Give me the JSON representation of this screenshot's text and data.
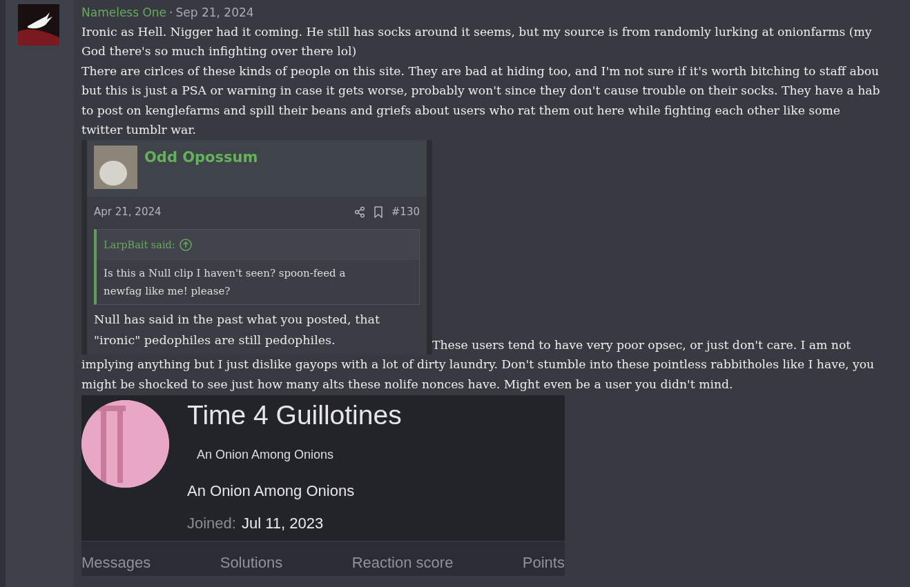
{
  "post": {
    "author": "Nameless One",
    "separator": "·",
    "date": "Sep 21, 2024",
    "paragraphs": [
      [
        "Ironic as Hell. Nigger had it coming. He still has socks around it seems, but my source is from randomly lurking at onionfarms (my",
        "God there's so much infighting over there lol)"
      ],
      [
        "There are cirlces of these kinds of people on this site. They are bad at hiding too, and I'm not sure if it's worth bitching to staff abou",
        "but this is just a PSA or warning in case it gets worse, probably won't since they don't cause trouble on their socks. They have a hab",
        "to post on kenglefarms and spill their beans and griefs about users who rat them out here while fighting each other like some",
        "twitter tumblr war."
      ]
    ],
    "embedded_post": {
      "author": "Odd Opossum",
      "date": "Apr 21, 2024",
      "number": "#130",
      "quote": {
        "author": "LarpBait said:",
        "lines": [
          "Is this a Null clip I haven't seen? spoon-feed a",
          "newfag like me! please?"
        ]
      },
      "body_lines": [
        "Null has said in the past what you posted, that",
        "\"ironic\" pedophiles are still pedophiles."
      ]
    },
    "after_embed_lines": [
      "These users tend to have very poor opsec, or just don't care. I am not",
      "implying anything but I just dislike gayops with a lot of dirty laundry. Don't stumble into these pointless rabbitholes like I have, you",
      "might be shocked to see just how many alts these nolife nonces have. Might even be a user you didn't mind."
    ],
    "embedded_profile": {
      "name": "Time 4 Guillotines",
      "banner": "An Onion Among Onions",
      "title": "An Onion Among Onions",
      "joined_label": "Joined:",
      "joined_date": "Jul 11, 2023",
      "stats": [
        "Messages",
        "Solutions",
        "Reaction score",
        "Points"
      ]
    }
  }
}
